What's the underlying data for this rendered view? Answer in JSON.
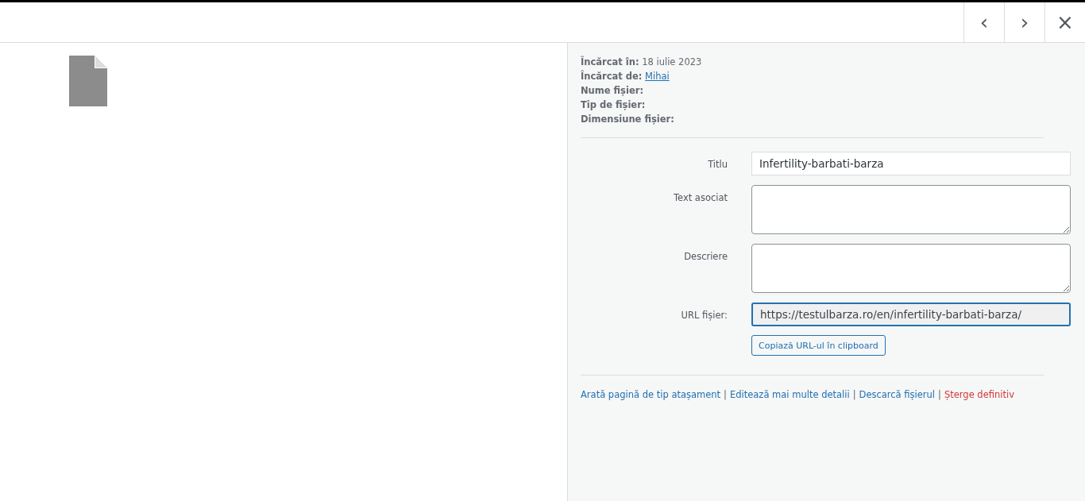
{
  "nav": {
    "prev": "‹",
    "next": "›",
    "close": "×"
  },
  "meta": [
    {
      "label": "Încărcat în:",
      "value": "18 iulie 2023",
      "kind": "text"
    },
    {
      "label": "Încărcat de:",
      "value": "Mihai",
      "kind": "link"
    },
    {
      "label": "Nume fișier:"
    },
    {
      "label": "Tip de fișier:"
    },
    {
      "label": "Dimensiune fișier:"
    }
  ],
  "fields": [
    {
      "label": "Titlu",
      "kind": "input",
      "value": "Infertility-barbati-barza",
      "focused": false
    },
    {
      "label": "Text asociat",
      "kind": "textarea",
      "focused": false
    },
    {
      "label": "Descriere",
      "kind": "textarea",
      "focused": false
    },
    {
      "label": "URL fișier:",
      "kind": "readonly",
      "value": "https://testulbarza.ro/en/infertility-barbati-barza/",
      "focused": true
    }
  ],
  "copy_button": "Copiază URL-ul în clipboard",
  "separator": "|",
  "actions": [
    {
      "label": "Arată pagină de tip atașament",
      "kind": "link"
    },
    {
      "label": "Editează mai multe detalii",
      "kind": "link"
    },
    {
      "label": "Descarcă fișierul",
      "kind": "link"
    },
    {
      "label": "Șterge definitiv",
      "kind": "danger"
    }
  ]
}
